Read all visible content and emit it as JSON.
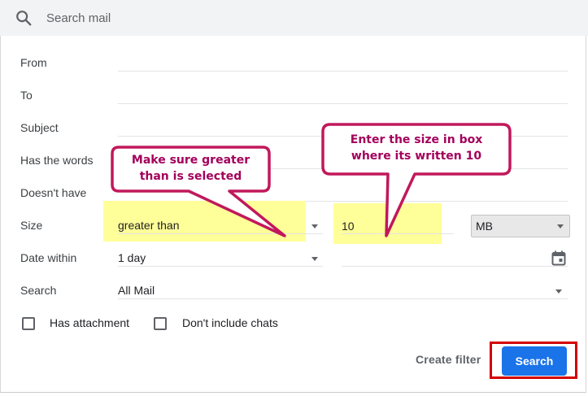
{
  "search": {
    "placeholder": "Search mail"
  },
  "form": {
    "from_label": "From",
    "to_label": "To",
    "subject_label": "Subject",
    "has_words_label": "Has the words",
    "doesnt_have_label": "Doesn't have",
    "size_label": "Size",
    "size_operator": "greater than",
    "size_value": "10",
    "size_unit": "MB",
    "date_within_label": "Date within",
    "date_within_value": "1 day",
    "search_label": "Search",
    "search_scope": "All Mail",
    "has_attachment_label": "Has attachment",
    "dont_include_chats_label": "Don't include chats",
    "create_filter_label": "Create filter",
    "search_button_label": "Search"
  },
  "annotations": {
    "callout_operator_line1": "Make sure greater",
    "callout_operator_line2": "than is selected",
    "callout_size_line1": "Enter the size in box",
    "callout_size_line2": "where its written 10"
  },
  "colors": {
    "accent": "#1a73e8",
    "highlight": "#ffff99",
    "callout_border": "#c2185b",
    "callout_text": "#a3005a",
    "frame_red": "#d40000"
  }
}
